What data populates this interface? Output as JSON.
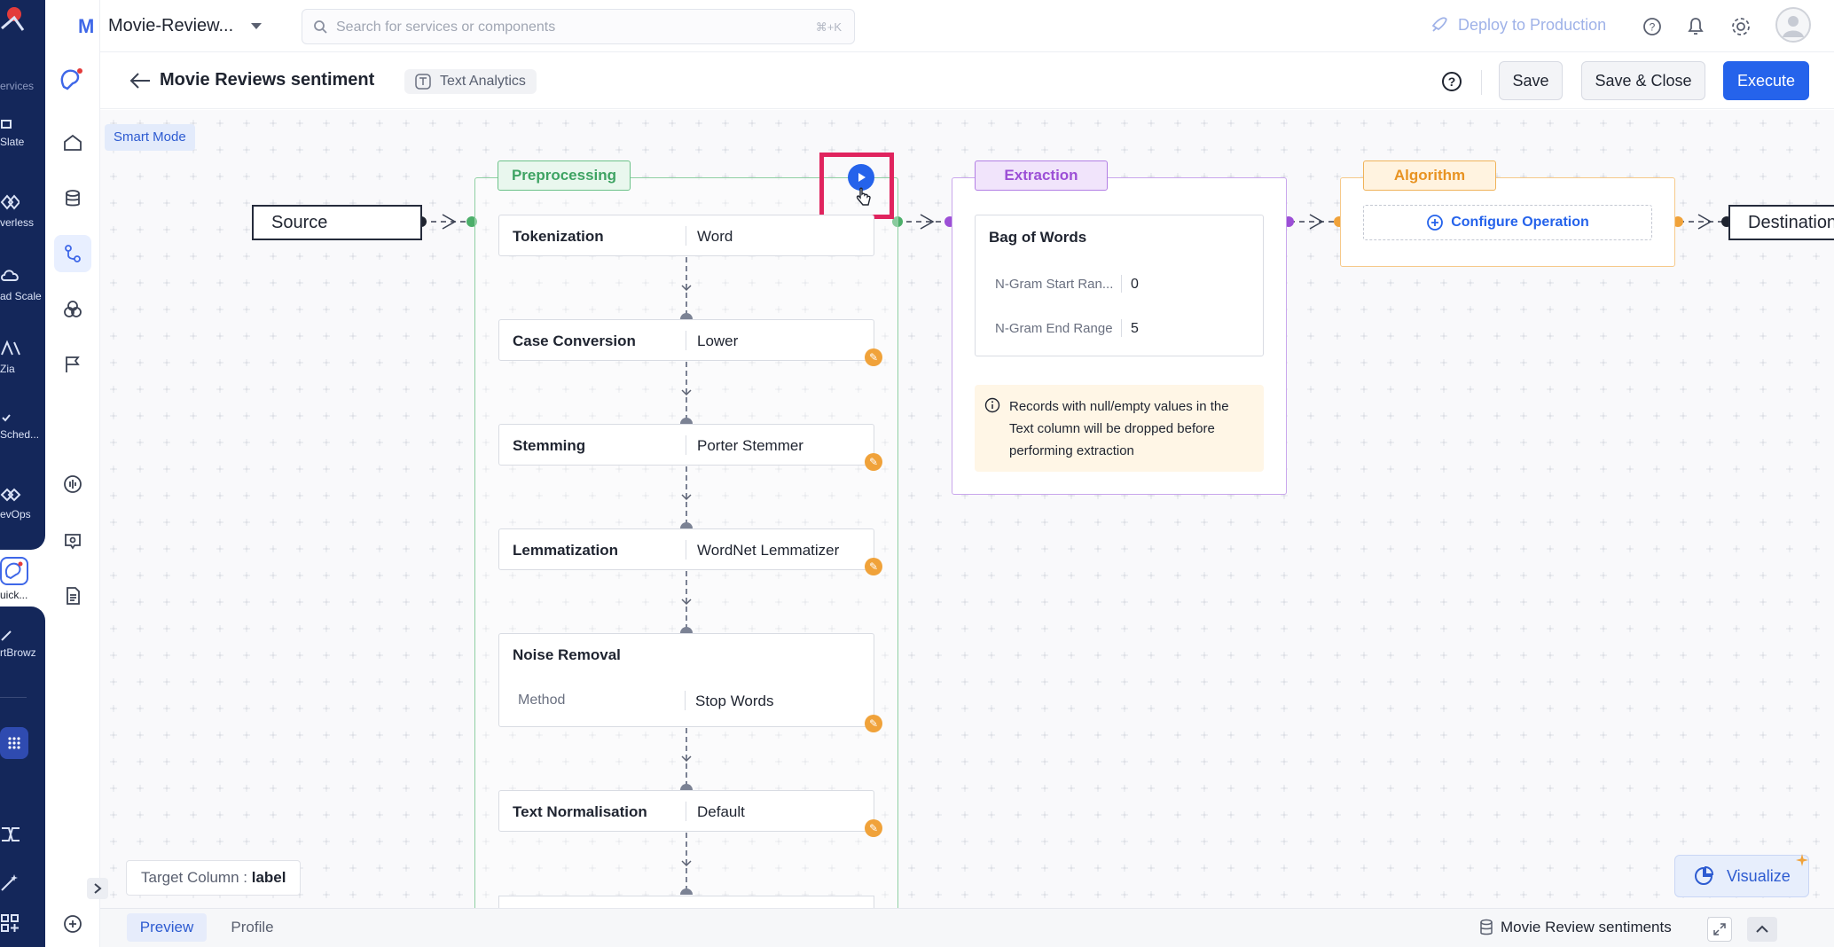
{
  "rail": {
    "items": [
      {
        "label": "ervices"
      },
      {
        "label": "Slate"
      },
      {
        "label": "verless"
      },
      {
        "label": "ad Scale"
      },
      {
        "label": "Zia"
      },
      {
        "label": "Sched..."
      },
      {
        "label": "evOps"
      },
      {
        "label": "uick..."
      },
      {
        "label": "rtBrowz"
      }
    ]
  },
  "topbar": {
    "project_initial": "M",
    "project_name": "Movie-Review...",
    "search_placeholder": "Search for services or components",
    "search_shortcut": "⌘+K",
    "deploy_label": "Deploy to Production"
  },
  "header": {
    "title": "Movie Reviews sentiment",
    "tag": "Text Analytics",
    "save_label": "Save",
    "save_close_label": "Save & Close",
    "execute_label": "Execute"
  },
  "canvas": {
    "smart_mode": "Smart Mode",
    "source_label": "Source",
    "destination_label": "Destination",
    "preprocessing": {
      "title": "Preprocessing",
      "operations": [
        {
          "name": "Tokenization",
          "value": "Word"
        },
        {
          "name": "Case Conversion",
          "value": "Lower"
        },
        {
          "name": "Stemming",
          "value": "Porter Stemmer"
        },
        {
          "name": "Lemmatization",
          "value": "WordNet Lemmatizer"
        },
        {
          "name": "Noise Removal",
          "sub_label": "Method",
          "value": "Stop Words"
        },
        {
          "name": "Text Normalisation",
          "value": "Default"
        }
      ]
    },
    "extraction": {
      "title": "Extraction",
      "card_title": "Bag of Words",
      "params": [
        {
          "label": "N-Gram Start Ran...",
          "value": "0"
        },
        {
          "label": "N-Gram End Range",
          "value": "5"
        }
      ],
      "note": "Records with null/empty values in the Text column will be dropped before performing extraction"
    },
    "algorithm": {
      "title": "Algorithm",
      "configure_label": "Configure Operation"
    },
    "target_column_label": "Target Column :",
    "target_column_value": "label",
    "visualize_label": "Visualize"
  },
  "bottombar": {
    "tabs": [
      "Preview",
      "Profile"
    ],
    "dataset_name": "Movie Review sentiments"
  },
  "colors": {
    "primary": "#2563eb",
    "preprocessing": "#4caf6a",
    "extraction": "#9c4fd6",
    "algorithm": "#f0a23a",
    "highlight": "#e0245e"
  }
}
